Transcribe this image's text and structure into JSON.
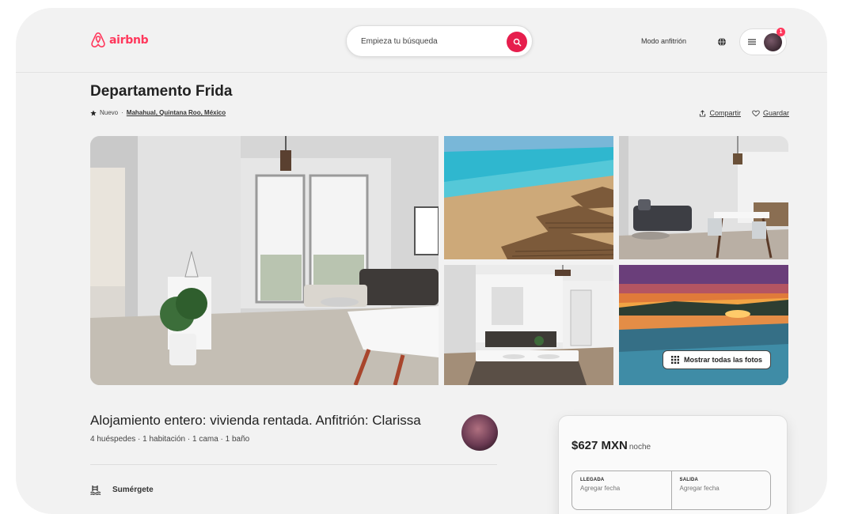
{
  "header": {
    "logo_text": "airbnb",
    "search_placeholder": "Empieza tu búsqueda",
    "host_mode_label": "Modo anfitrión",
    "notification_count": "1"
  },
  "listing": {
    "title": "Departamento Frida",
    "badge": "Nuevo",
    "separator": "·",
    "location": "Mahahual, Quintana Roo, México",
    "share_label": "Compartir",
    "save_label": "Guardar"
  },
  "gallery": {
    "show_all_label": "Mostrar todas las fotos"
  },
  "host_section": {
    "title": "Alojamiento entero: vivienda rentada. Anfitrión: Clarissa",
    "details": "4 huéspedes · 1 habitación · 1 cama · 1 baño",
    "feature_label": "Sumérgete"
  },
  "booking": {
    "price": "$627 MXN",
    "price_unit": "noche",
    "checkin_label": "LLEGADA",
    "checkin_value": "Agregar fecha",
    "checkout_label": "SALIDA",
    "checkout_value": "Agregar fecha"
  },
  "colors": {
    "brand": "#ff385c",
    "search_button": "#e61e4d"
  }
}
